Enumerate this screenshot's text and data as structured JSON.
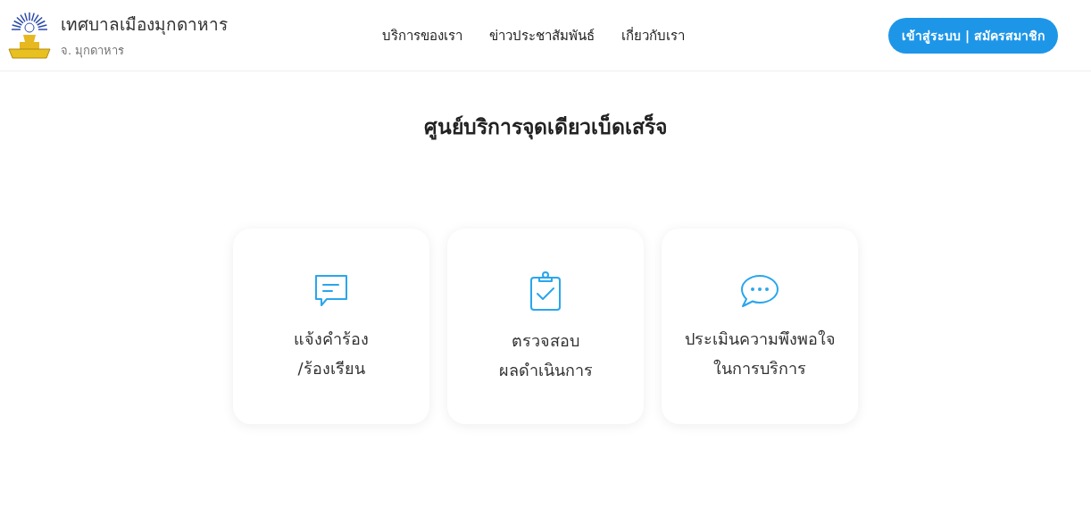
{
  "header": {
    "title": "เทศบาลเมืองมุกดาหาร",
    "subtitle": "จ. มุกดาหาร",
    "nav": [
      {
        "label": "บริการของเรา"
      },
      {
        "label": "ข่าวประชาสัมพันธ์"
      },
      {
        "label": "เกี่ยวกับเรา"
      }
    ],
    "login_button": "เข้าสู่ระบบ | สมัครสมาชิก"
  },
  "heading": "ศูนย์บริการจุดเดียวเบ็ดเสร็จ",
  "cards": [
    {
      "kind": "message",
      "lines": [
        "แจ้งคำร้อง",
        "/ร้องเรียน"
      ]
    },
    {
      "kind": "clipboard",
      "lines": [
        "ตรวจสอบ",
        "ผลดำเนินการ"
      ]
    },
    {
      "kind": "chat",
      "lines": [
        "ประเมินความพึงพอใจ",
        "ในการบริการ"
      ]
    }
  ]
}
